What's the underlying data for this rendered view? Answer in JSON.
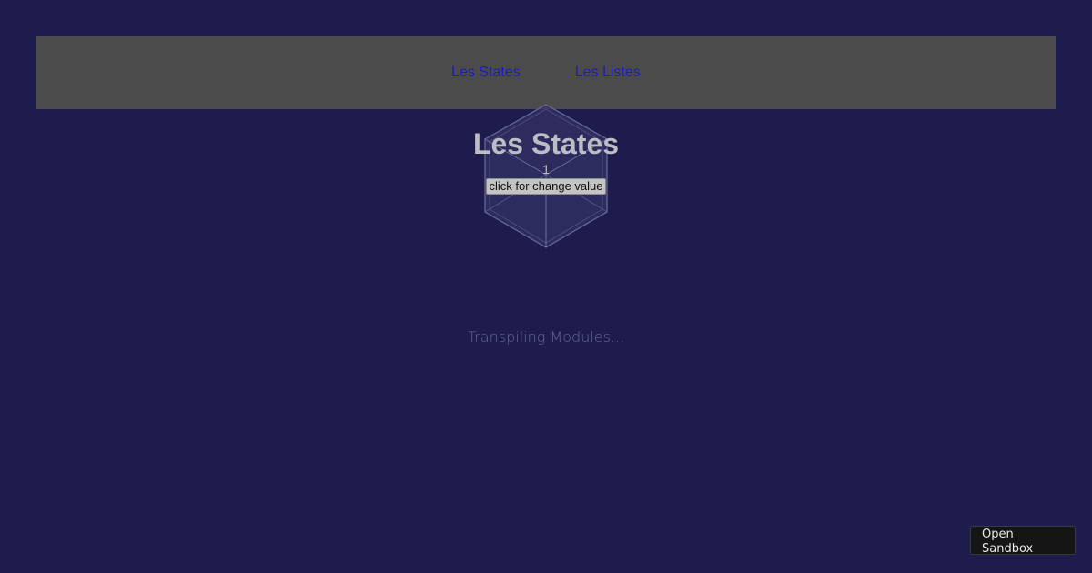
{
  "nav": {
    "items": [
      {
        "label": "Les States"
      },
      {
        "label": "Les Listes"
      }
    ]
  },
  "main": {
    "title": "Les States",
    "counter": "1",
    "button_label": "click for change value"
  },
  "loader": {
    "text": "Transpiling Modules..."
  },
  "sandbox": {
    "label": "Open Sandbox"
  },
  "colors": {
    "background": "#1d1c4c",
    "nav_background": "#4b4b4b",
    "link": "#1d1cbe",
    "title": "#bdbdc4"
  },
  "icons": {
    "loader": "cube-icon"
  }
}
